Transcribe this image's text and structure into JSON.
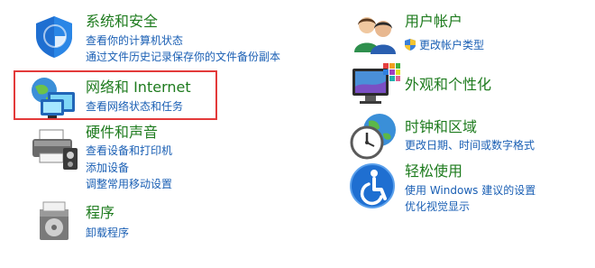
{
  "left": [
    {
      "title": "系统和安全",
      "links": [
        "查看你的计算机状态",
        "通过文件历史记录保存你的文件备份副本"
      ]
    },
    {
      "title": "网络和 Internet",
      "links": [
        "查看网络状态和任务"
      ]
    },
    {
      "title": "硬件和声音",
      "links": [
        "查看设备和打印机",
        "添加设备",
        "调整常用移动设置"
      ]
    },
    {
      "title": "程序",
      "links": [
        "卸载程序"
      ]
    }
  ],
  "right": [
    {
      "title": "用户帐户",
      "links": [
        "更改帐户类型"
      ]
    },
    {
      "title": "外观和个性化",
      "links": []
    },
    {
      "title": "时钟和区域",
      "links": [
        "更改日期、时间或数字格式"
      ]
    },
    {
      "title": "轻松使用",
      "links": [
        "使用 Windows 建议的设置",
        "优化视觉显示"
      ]
    }
  ],
  "colors": {
    "title": "#1e7b1e",
    "link": "#1a5fb4",
    "highlight": "#e33a3a"
  },
  "icons": [
    "shield-icon",
    "network-icon",
    "printer-icon",
    "programs-icon",
    "users-icon",
    "display-icon",
    "clock-icon",
    "accessibility-icon",
    "uac-shield-icon"
  ]
}
